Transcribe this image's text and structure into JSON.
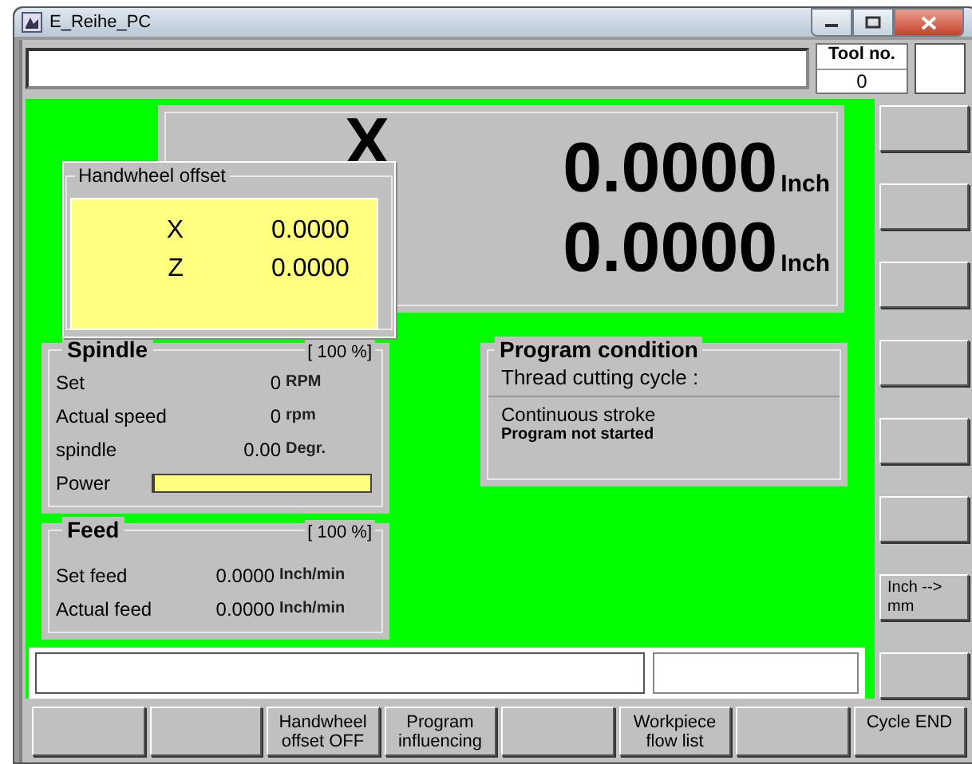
{
  "window": {
    "title": "E_Reihe_PC"
  },
  "tool": {
    "label": "Tool no.",
    "value": "0"
  },
  "axes": [
    {
      "name": "X",
      "value": "0.0000",
      "unit": "Inch"
    },
    {
      "value": "0.0000",
      "unit": "Inch"
    }
  ],
  "handwheel_offset": {
    "title": "Handwheel offset",
    "rows": [
      {
        "axis": "X",
        "value": "0.0000"
      },
      {
        "axis": "Z",
        "value": "0.0000"
      }
    ]
  },
  "spindle": {
    "title": "Spindle",
    "override": "[ 100 %]",
    "rows": [
      {
        "label": "Set",
        "value": "0",
        "unit": "RPM"
      },
      {
        "label": "Actual speed",
        "value": "0",
        "unit": "rpm"
      },
      {
        "label": "spindle",
        "value": "0.00",
        "unit": "Degr."
      }
    ],
    "power": {
      "label": "Power",
      "level": 0.01
    }
  },
  "feed": {
    "title": "Feed",
    "override": "[ 100 %]",
    "rows": [
      {
        "label": "Set feed",
        "value": "0.0000",
        "unit": "Inch/min"
      },
      {
        "label": "Actual feed",
        "value": "0.0000",
        "unit": "Inch/min"
      }
    ]
  },
  "program_condition": {
    "title": "Program condition",
    "cycle": "Thread cutting cycle  :",
    "mode": "Continuous stroke",
    "status": "Program not started"
  },
  "side_buttons": [
    {
      "kind": "blank"
    },
    {
      "kind": "blank"
    },
    {
      "kind": "blank"
    },
    {
      "kind": "blank"
    },
    {
      "kind": "blank"
    },
    {
      "kind": "blank"
    },
    {
      "kind": "text",
      "label": "Inch -->\nmm"
    },
    {
      "kind": "blank"
    }
  ],
  "softkeys": [
    {
      "kind": "blank"
    },
    {
      "kind": "blank"
    },
    {
      "kind": "text",
      "label": "Handwheel\noffset OFF"
    },
    {
      "kind": "text",
      "label": "Program\ninfluencing"
    },
    {
      "kind": "blank"
    },
    {
      "kind": "text",
      "label": "Workpiece\nflow list"
    },
    {
      "kind": "blank"
    },
    {
      "kind": "text",
      "label": "Cycle END"
    }
  ]
}
